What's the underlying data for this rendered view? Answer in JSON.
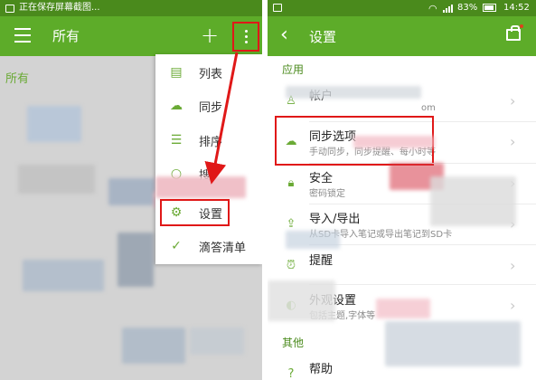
{
  "left": {
    "status_text": "正在保存屏幕截图...",
    "appbar_title": "所有",
    "section_label": "所有",
    "menu": [
      {
        "label": "列表",
        "icon": "list-icon"
      },
      {
        "label": "同步",
        "icon": "cloud-sync-icon"
      },
      {
        "label": "排序",
        "icon": "sort-icon"
      },
      {
        "label": "搜",
        "icon": "search-icon"
      },
      {
        "label": "设置",
        "icon": "gear-icon"
      },
      {
        "label": "滴答清单",
        "icon": "check-circle-icon"
      }
    ]
  },
  "right": {
    "status": {
      "battery": "83%",
      "time": "14:52"
    },
    "appbar_title": "设置",
    "sections": [
      {
        "label": "应用"
      },
      {
        "label": "其他"
      }
    ],
    "items": [
      {
        "title": "帐户",
        "subtitle": "om",
        "icon": "person-icon"
      },
      {
        "title": "同步选项",
        "subtitle": "手动同步，同步提醒、每小时等",
        "icon": "cloud-sync-icon"
      },
      {
        "title": "安全",
        "subtitle": "密码锁定",
        "icon": "lock-icon"
      },
      {
        "title": "导入/导出",
        "subtitle": "从SD卡导入笔记或导出笔记到SD卡",
        "icon": "export-icon"
      },
      {
        "title": "提醒",
        "subtitle": "",
        "icon": "alarm-icon"
      },
      {
        "title": "外观设置",
        "subtitle": "包括主题,字体等",
        "icon": "palette-icon"
      },
      {
        "title": "帮助",
        "subtitle": "",
        "icon": "help-icon"
      }
    ]
  },
  "colors": {
    "appbar": "#5dac29",
    "status_bar": "#4a8a1c",
    "accent": "#6aaa35",
    "highlight": "#e01818"
  }
}
